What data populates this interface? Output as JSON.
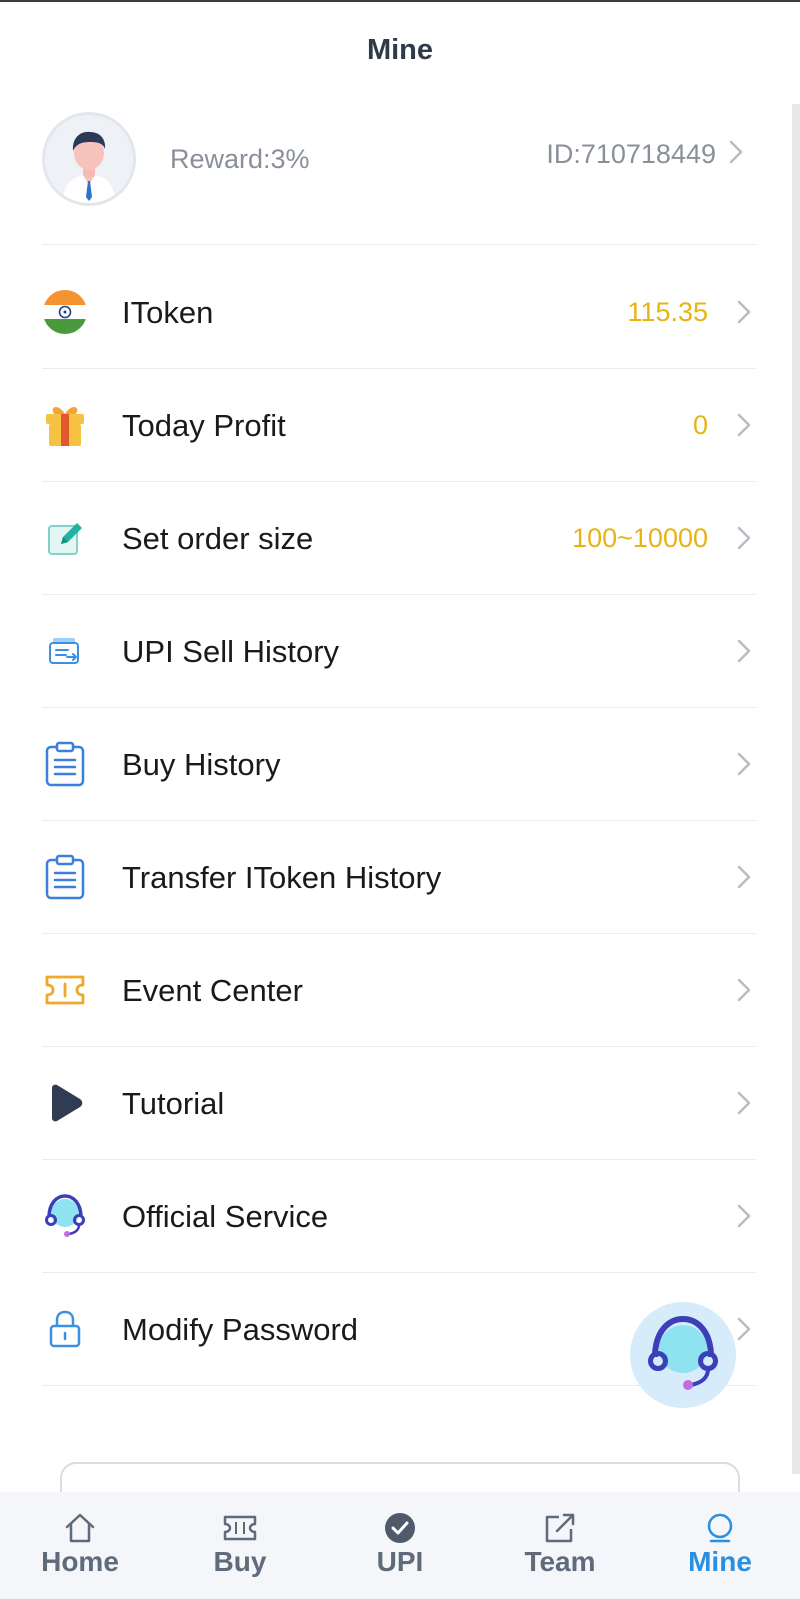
{
  "header": {
    "title": "Mine"
  },
  "profile": {
    "reward": "Reward:3%",
    "user_id": "ID:710718449"
  },
  "menu": [
    {
      "label": "IToken",
      "value": "115.35",
      "icon": "india-flag-icon"
    },
    {
      "label": "Today Profit",
      "value": "0",
      "icon": "gift-icon"
    },
    {
      "label": "Set order size",
      "value": "100~10000",
      "icon": "edit-icon"
    },
    {
      "label": "UPI Sell History",
      "value": "",
      "icon": "wallet-transfer-icon"
    },
    {
      "label": "Buy History",
      "value": "",
      "icon": "clipboard-icon"
    },
    {
      "label": "Transfer IToken History",
      "value": "",
      "icon": "clipboard-icon"
    },
    {
      "label": "Event Center",
      "value": "",
      "icon": "ticket-icon"
    },
    {
      "label": "Tutorial",
      "value": "",
      "icon": "play-icon"
    },
    {
      "label": "Official Service",
      "value": "",
      "icon": "headset-icon"
    },
    {
      "label": "Modify Password",
      "value": "",
      "icon": "lock-icon"
    }
  ],
  "tabs": [
    {
      "label": "Home",
      "icon": "home-icon",
      "active": false
    },
    {
      "label": "Buy",
      "icon": "ticket-icon",
      "active": false
    },
    {
      "label": "UPI",
      "icon": "check-circle-icon",
      "active": false
    },
    {
      "label": "Team",
      "icon": "share-icon",
      "active": false
    },
    {
      "label": "Mine",
      "icon": "user-icon",
      "active": true
    }
  ],
  "colors": {
    "accent": "#2a8fdf",
    "value_gold": "#e8b313",
    "title": "#2f3a4a",
    "muted": "#8a9099",
    "tab_inactive": "#5f6b7b"
  }
}
